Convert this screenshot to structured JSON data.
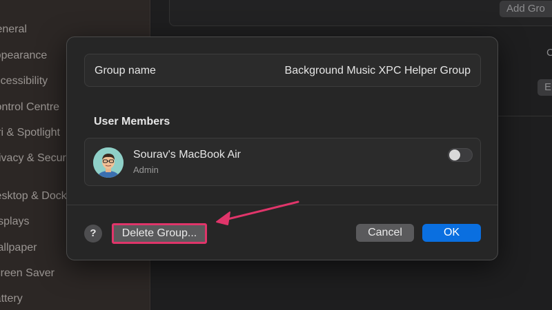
{
  "sidebar": {
    "items": [
      {
        "label": "General"
      },
      {
        "label": "Appearance"
      },
      {
        "label": "Accessibility"
      },
      {
        "label": "Control Centre"
      },
      {
        "label": "Siri & Spotlight"
      },
      {
        "label": "Privacy & Security"
      },
      {
        "label": "Desktop & Dock"
      },
      {
        "label": "Displays"
      },
      {
        "label": "Wallpaper"
      },
      {
        "label": "Screen Saver"
      },
      {
        "label": "Battery"
      }
    ]
  },
  "background": {
    "add_button_label": "Add Gro",
    "edge_letter": "C",
    "edge_button_label": "E"
  },
  "dialog": {
    "group_name_label": "Group name",
    "group_name_value": "Background Music XPC Helper Group",
    "members_title": "User Members",
    "member": {
      "name": "Sourav's MacBook Air",
      "role": "Admin",
      "toggle_on": false
    },
    "help_label": "?",
    "delete_label": "Delete Group...",
    "cancel_label": "Cancel",
    "ok_label": "OK"
  },
  "colors": {
    "accent": "#0a6fe0",
    "annotation": "#e0356a"
  }
}
